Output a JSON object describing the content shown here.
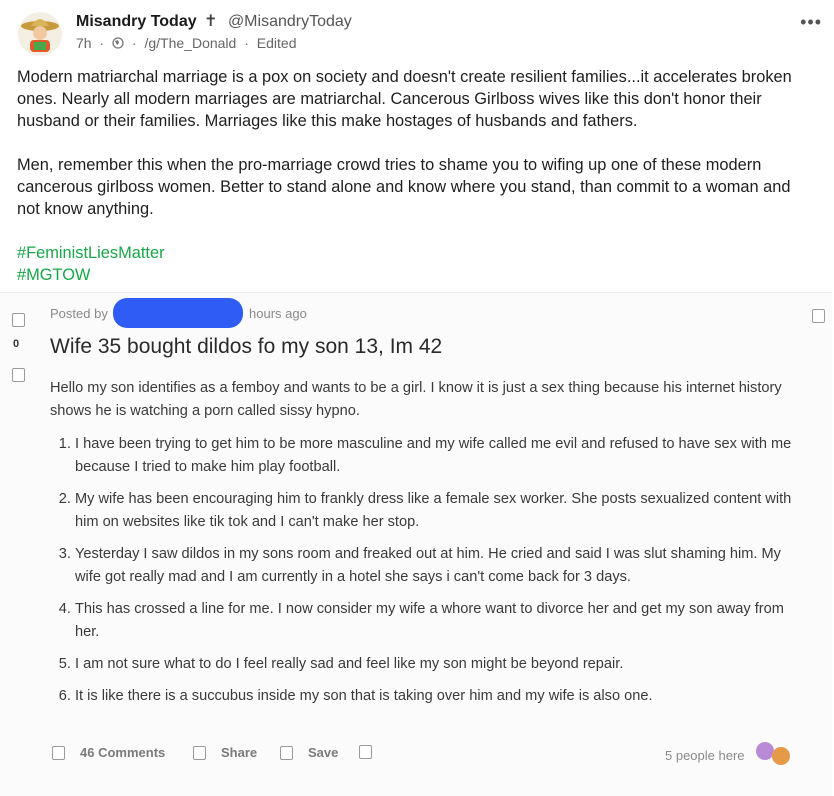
{
  "header": {
    "display_name": "Misandry Today",
    "cross_glyph": "✝",
    "handle": "@MisandryToday",
    "time": "7h",
    "dot1": "·",
    "community": "/g/The_Donald",
    "dot2": "·",
    "edited": "Edited",
    "more": "•••"
  },
  "post": {
    "paragraph1": "Modern matriarchal marriage is a pox on society and doesn't create resilient families...it accelerates broken ones. Nearly all modern marriages are matriarchal. Cancerous Girlboss wives like this don't honor their husband or their families. Marriages like this make hostages of husbands and fathers.",
    "paragraph2": "Men, remember this when the pro-marriage crowd tries to shame you to wifing up one of these modern cancerous girlboss women. Better to stand alone and know where you stand, than commit to a woman and not know anything.",
    "hashtags": [
      "#FeministLiesMatter",
      "#MGTOW"
    ],
    "hashtag_color": "#1aa54a"
  },
  "screenshot": {
    "posted_by": "Posted by",
    "hours_ago": "hours ago",
    "vote_count": "0",
    "title": "Wife 35 bought dildos fo my son 13, Im 42",
    "intro": "Hello my son identifies as a femboy and wants to be a girl. I know it is just a sex thing because his internet history shows he is watching a porn called sissy hypno.",
    "items": [
      "I have been trying to get him to be more masculine and my wife called me evil and refused to have sex with me because I tried to make him play football.",
      "My wife has been encouraging him to frankly dress like a female sex worker. She posts sexualized content with him on websites like tik tok and I can't make her stop.",
      "Yesterday I saw dildos in my sons room and freaked out at him. He cried and said I was slut shaming him. My wife got really mad and I am currently in a hotel she says i can't come back for 3 days.",
      "This has crossed a line for me. I now consider my wife a whore want to divorce her and get my son away from her.",
      "I am not sure what to do I feel really sad and feel like my son might be beyond repair.",
      "It is like there is a succubus inside my son that is taking over him and my wife is also one."
    ],
    "comments": "46 Comments",
    "share": "Share",
    "save": "Save",
    "people_here": "5 people here",
    "redaction_color": "#2e5cf5"
  }
}
